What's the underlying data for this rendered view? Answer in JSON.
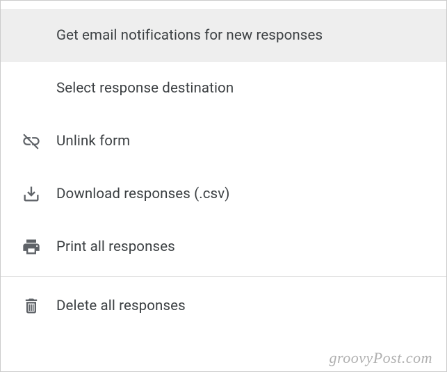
{
  "menu": {
    "items": [
      {
        "label": "Get email notifications for new responses",
        "icon": null,
        "highlighted": true
      },
      {
        "label": "Select response destination",
        "icon": null,
        "highlighted": false
      },
      {
        "label": "Unlink form",
        "icon": "unlink",
        "highlighted": false
      },
      {
        "label": "Download responses (.csv)",
        "icon": "download",
        "highlighted": false
      },
      {
        "label": "Print all responses",
        "icon": "print",
        "highlighted": false
      },
      {
        "label": "Delete all responses",
        "icon": "delete",
        "highlighted": false,
        "separated": true
      }
    ]
  },
  "watermark": "groovyPost.com"
}
